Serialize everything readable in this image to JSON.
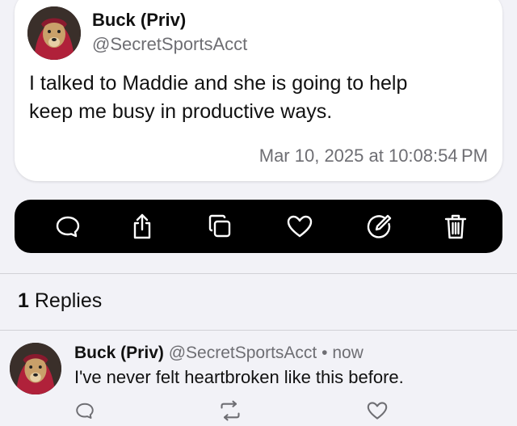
{
  "post": {
    "author_name": "Buck (Priv)",
    "author_handle": "@SecretSportsAcct",
    "text_line1": "I talked to Maddie and she is going to help",
    "text_line2": "keep me busy in productive ways.",
    "timestamp": "Mar 10, 2025 at 10:08:54 PM"
  },
  "toolbar": {
    "icons": [
      "reply-icon",
      "share-icon",
      "copy-icon",
      "like-icon",
      "edit-icon",
      "delete-icon"
    ],
    "background": "#000000",
    "icon_color": "#ffffff"
  },
  "replies_section": {
    "count": "1",
    "label": "Replies"
  },
  "reply": {
    "author_name": "Buck (Priv)",
    "author_handle": "@SecretSportsAcct",
    "separator": "•",
    "time": "now",
    "text": "I've never felt heartbroken like this before.",
    "icons": [
      "reply-icon",
      "repost-icon",
      "like-icon"
    ]
  },
  "colors": {
    "background": "#f2f2f7",
    "card": "#ffffff",
    "secondary_text": "#6e6e73"
  }
}
